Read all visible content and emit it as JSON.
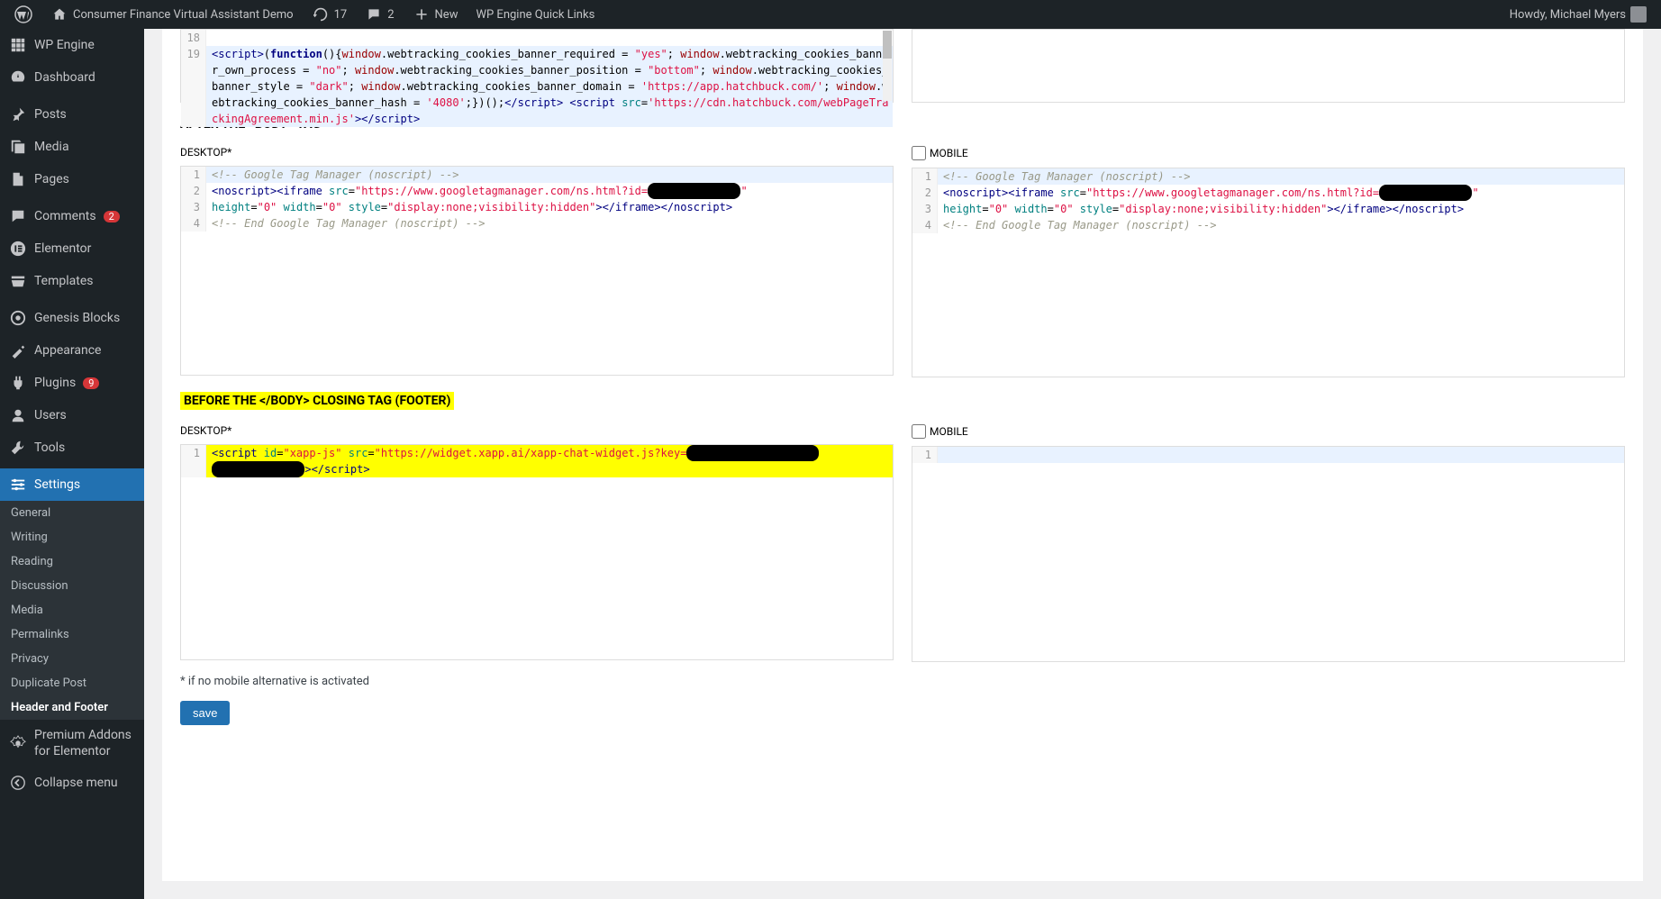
{
  "toolbar": {
    "site_name": "Consumer Finance Virtual Assistant Demo",
    "updates": "17",
    "comments": "2",
    "new": "New",
    "wpengine": "WP Engine Quick Links",
    "howdy": "Howdy, Michael Myers"
  },
  "sidebar": {
    "items": [
      {
        "label": "WP Engine",
        "icon": "wpengine"
      },
      {
        "label": "Dashboard",
        "icon": "dashboard"
      },
      {
        "label": "Posts",
        "icon": "pin"
      },
      {
        "label": "Media",
        "icon": "media"
      },
      {
        "label": "Pages",
        "icon": "pages"
      },
      {
        "label": "Comments",
        "icon": "comments",
        "badge": "2"
      },
      {
        "label": "Elementor",
        "icon": "elementor"
      },
      {
        "label": "Templates",
        "icon": "templates"
      },
      {
        "label": "Genesis Blocks",
        "icon": "genesis"
      },
      {
        "label": "Appearance",
        "icon": "appearance"
      },
      {
        "label": "Plugins",
        "icon": "plugins",
        "badge": "9"
      },
      {
        "label": "Users",
        "icon": "users"
      },
      {
        "label": "Tools",
        "icon": "tools"
      },
      {
        "label": "Settings",
        "icon": "settings",
        "active": true
      }
    ],
    "submenu": [
      {
        "label": "General"
      },
      {
        "label": "Writing"
      },
      {
        "label": "Reading"
      },
      {
        "label": "Discussion"
      },
      {
        "label": "Media"
      },
      {
        "label": "Permalinks"
      },
      {
        "label": "Privacy"
      },
      {
        "label": "Duplicate Post"
      },
      {
        "label": "Header and Footer",
        "current": true
      }
    ],
    "premium": "Premium Addons for Elementor",
    "collapse": "Collapse menu"
  },
  "sections": {
    "head_top_lines": [
      "18",
      "19"
    ],
    "head_top_code": {
      "l19_a": "<script>",
      "l19_b": "(",
      "l19_c": "function",
      "l19_d": "(){",
      "l19_e": "window",
      "l19_f": ".webtracking_cookies_banner_required = ",
      "l19_g": "\"yes\"",
      "l19_h": ";",
      "l19_i": " window",
      "l19_j": ".webtracking_cookies_banner_own_process = ",
      "l19_k": "\"no\"",
      "l19_l": "; ",
      "l19_m": "window",
      "l19_n": ".webtracking_cookies_banner_position = ",
      "l19_o": "\"bottom\"",
      "l19_p": "; ",
      "l19_q": "window",
      "l19_r": ".webtracking_cookies_banner_style = ",
      "l19_s": "\"dark\"",
      "l19_t": "; ",
      "l19_u": "window",
      "l19_v": ".webtracking_cookies_banner_domain = ",
      "l19_w": "'https://app.hatchbuck.com/'",
      "l19_x": "; ",
      "l19_y": "window",
      "l19_z": ".webtracking_cookies_banner_hash = ",
      "l19_aa": "'4080'",
      "l19_ab": ";})();",
      "l19_ac": "</script>",
      "l19_ad": " <script ",
      "l19_ae": "src",
      "l19_af": "=",
      "l19_ag": "'https://cdn.hatchbuck.com/webPageTrackingAgreement.min.js'",
      "l19_ah": "></script>"
    },
    "after_body_title": "AFTER THE <BODY> TAG",
    "desktop_label": "DESKTOP*",
    "mobile_label": "MOBILE",
    "gtm_d": {
      "l1": "<!-- Google Tag Manager (noscript) -->",
      "l2a": "<noscript><iframe ",
      "l2b": "src",
      "l2c": "=",
      "l2d": "\"https://www.googletagmanager.com/ns.html?id=",
      "l2e": "\"",
      "l3a": "height",
      "l3b": "=",
      "l3c": "\"0\"",
      "l3d": " width",
      "l3e": "=",
      "l3f": "\"0\"",
      "l3g": " style",
      "l3h": "=",
      "l3i": "\"display:none;visibility:hidden\"",
      "l3j": "></iframe></noscript>",
      "l4": "<!-- End Google Tag Manager (noscript) -->"
    },
    "footer_title": "BEFORE THE </BODY> CLOSING TAG (FOOTER)",
    "footer_d": {
      "l1a": "<script ",
      "l1b": "id",
      "l1c": "=",
      "l1d": "\"xapp-js\"",
      "l1e": " src",
      "l1f": "=",
      "l1g": "\"https://widget.xapp.ai/xapp-chat-widget.js?key=",
      "l1h": "></script>"
    },
    "footnote": "* if no mobile alternative is activated",
    "save": "save"
  }
}
